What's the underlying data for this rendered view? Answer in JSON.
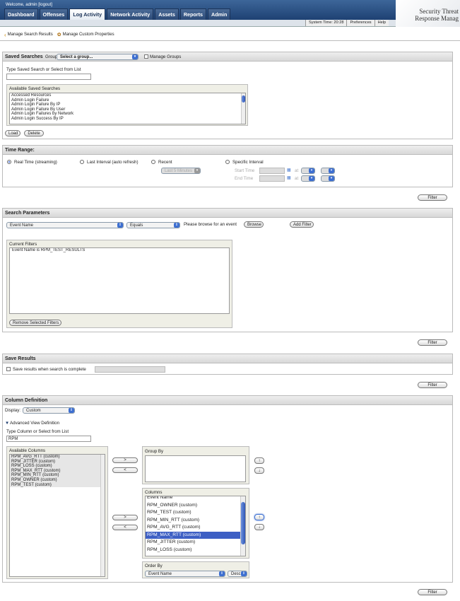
{
  "header": {
    "welcome": "Welcome, admin [logout]",
    "tabs": [
      "Dashboard",
      "Offenses",
      "Log Activity",
      "Network Activity",
      "Assets",
      "Reports",
      "Admin"
    ],
    "active_tab": "Log Activity",
    "system_time": "System Time: 20:28",
    "preferences": "Preferences",
    "help": "Help",
    "brand_line1": "Security Threat",
    "brand_line2": "Response Manag"
  },
  "toolbar": {
    "manage_search_results": "Manage Search Results",
    "manage_custom_properties": "Manage Custom Properties"
  },
  "saved_searches": {
    "title": "Saved Searches",
    "group_label": "Group:",
    "group_value": "Select a group...",
    "manage_groups": "Manage Groups",
    "type_label": "Type Saved Search or Select from List",
    "available_label": "Available Saved Searches",
    "items": [
      "Accessed Resources",
      "Admin Login Failure",
      "Admin Login Failure By IP",
      "Admin Login Failure By User",
      "Admin Login Failures by Network",
      "Admin Login Success By IP"
    ],
    "load": "Load",
    "delete": "Delete"
  },
  "time_range": {
    "title": "Time Range:",
    "real_time": "Real Time (streaming)",
    "last_interval": "Last Interval (auto refresh)",
    "recent": "Recent",
    "recent_value": "Last 5 Minutes",
    "specific": "Specific Interval",
    "start_time": "Start Time",
    "end_time": "End Time",
    "at": "at",
    "filter": "Filter"
  },
  "search_params": {
    "title": "Search Parameters",
    "field_value": "Event Name",
    "operator_value": "Equals",
    "browse_note": "Please browse for an event",
    "browse": "Browse",
    "add_filter": "Add Filter",
    "current_filters_label": "Current Filters",
    "current_filters": [
      "Event Name is RPM_TEST_RESULTS"
    ],
    "remove": "Remove Selected Filters",
    "filter": "Filter"
  },
  "save_results": {
    "title": "Save Results",
    "checkbox_label": "Save results when search is complete",
    "filter": "Filter"
  },
  "column_def": {
    "title": "Column Definition",
    "display_label": "Display:",
    "display_value": "Custom",
    "advanced": "Advanced View Definition",
    "type_label": "Type Column or Select from List",
    "type_value": "RPM",
    "available_label": "Available Columns",
    "available_items": [
      "RPM_AVG_RTT (custom)",
      "RPM_JITTER (custom)",
      "RPM_LOSS (custom)",
      "RPM_MAX_RTT (custom)",
      "RPM_MIN_RTT (custom)",
      "RPM_OWNER (custom)",
      "RPM_TEST (custom)"
    ],
    "group_by_label": "Group By",
    "columns_label": "Columns",
    "columns_items": [
      "Event Name",
      "RPM_OWNER (custom)",
      "RPM_TEST (custom)",
      "RPM_MIN_RTT (custom)",
      "RPM_AVG_RTT (custom)",
      "RPM_MAX_RTT (custom)",
      "RPM_JITTER (custom)",
      "RPM_LOSS (custom)"
    ],
    "columns_selected": "RPM_MAX_RTT (custom)",
    "order_by_label": "Order By",
    "order_by_value": "Event Name",
    "order_dir": "Desc",
    "add_arrow": ">",
    "remove_arrow": "<",
    "up_arrow": "↑",
    "down_arrow": "↓",
    "filter": "Filter"
  }
}
